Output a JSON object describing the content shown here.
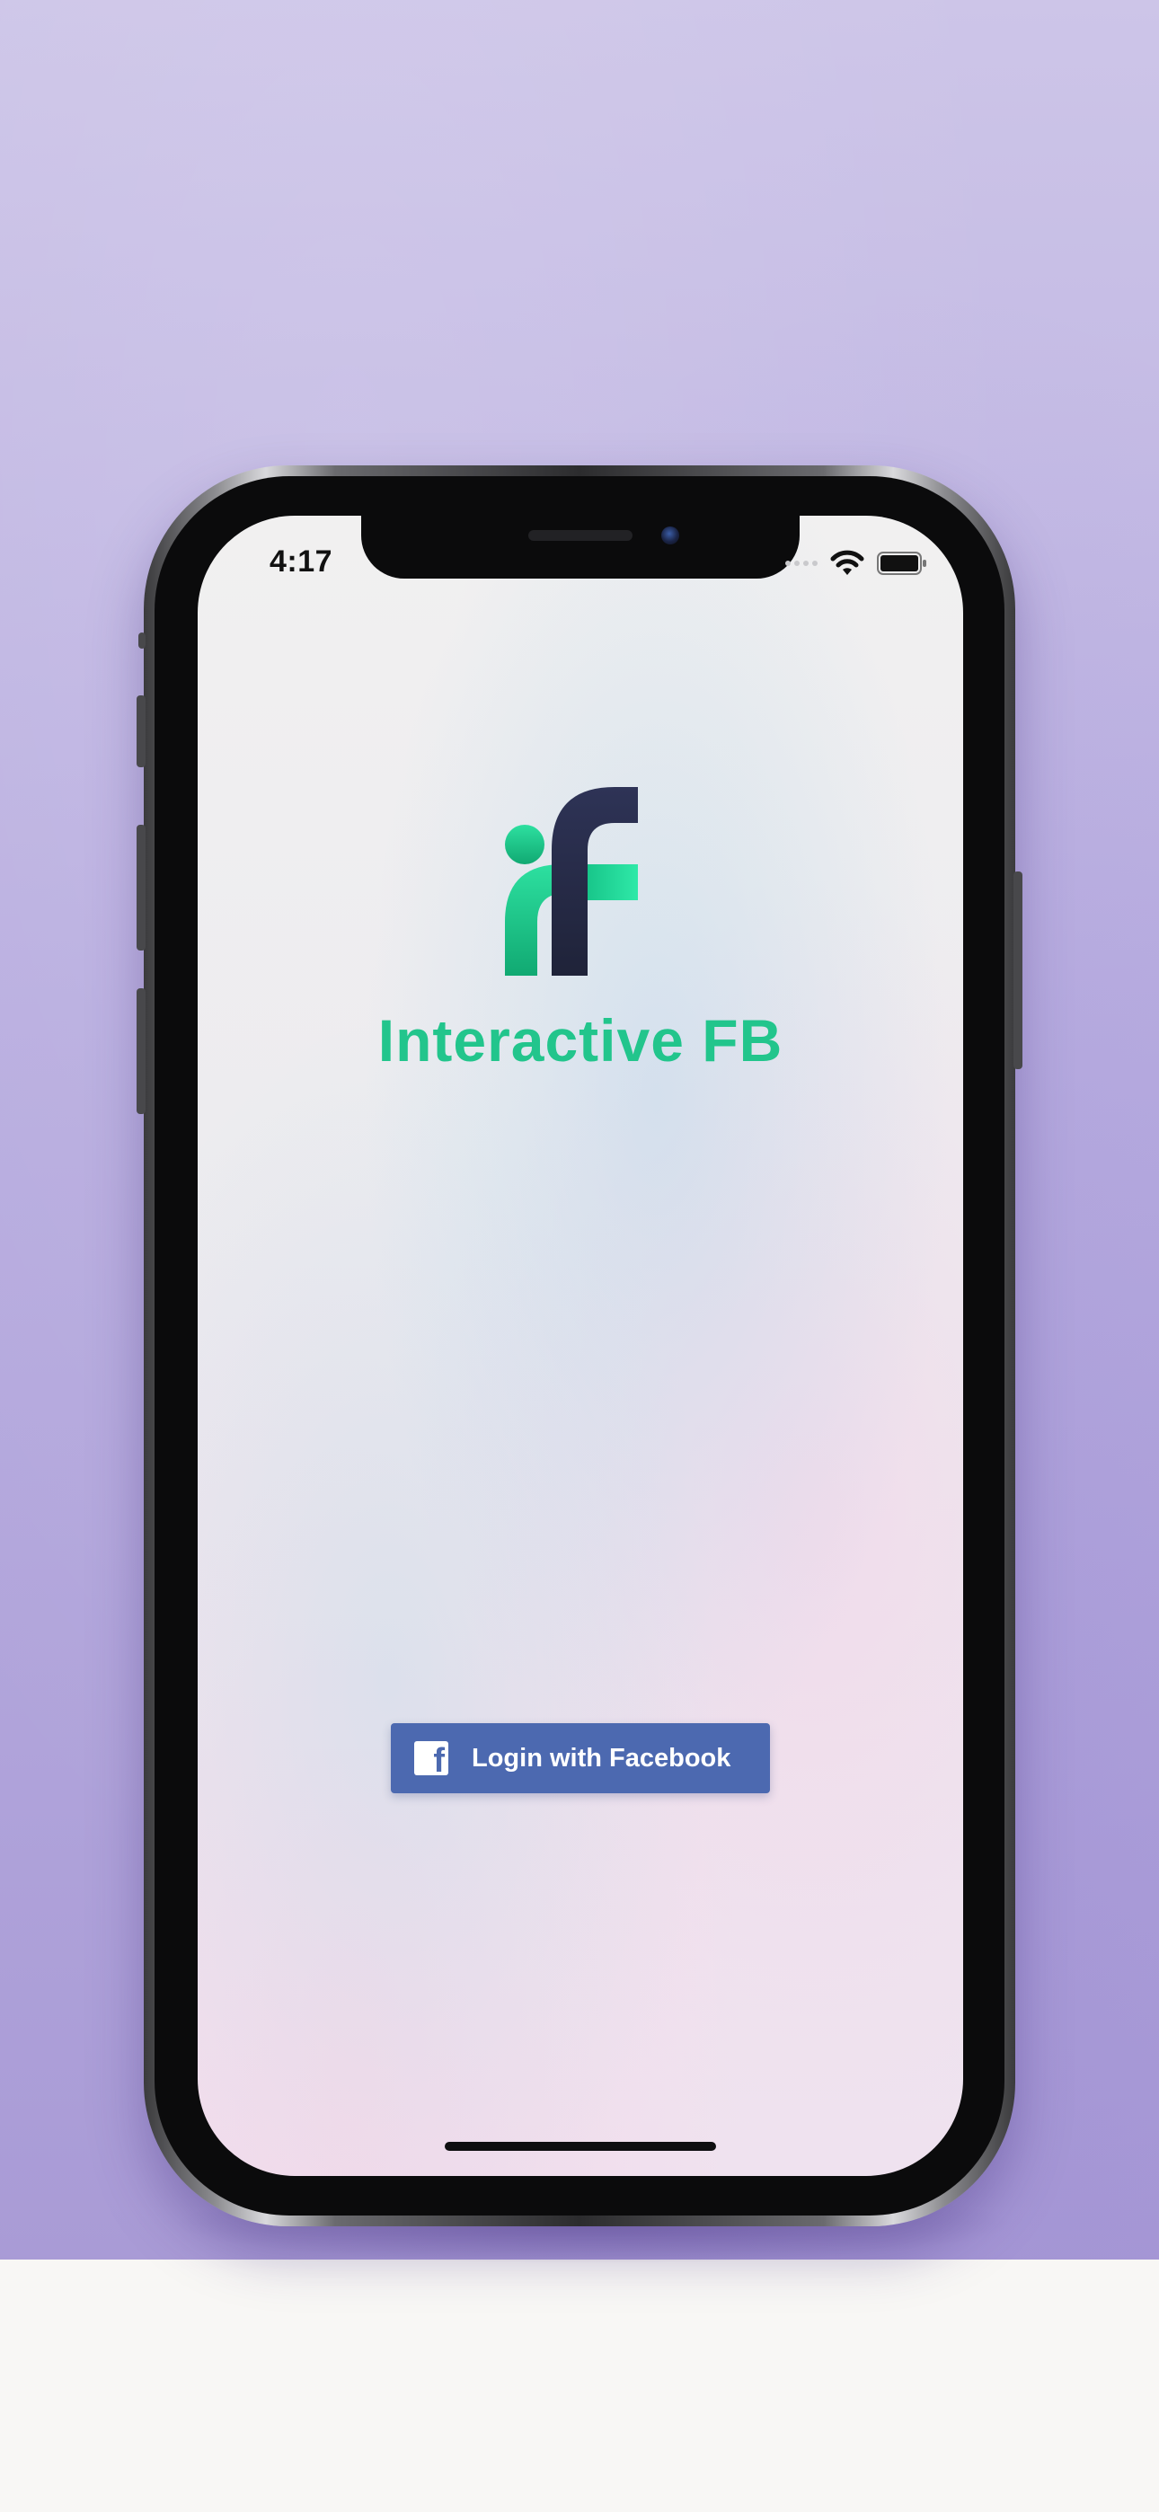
{
  "status_bar": {
    "time": "4:17",
    "icons": [
      "signal-dots-icon",
      "wifi-icon",
      "battery-icon"
    ]
  },
  "app": {
    "logo_icon": "interactive-fb-logo-icon",
    "title": "Interactive FB",
    "title_color": "#22c58c"
  },
  "login_button": {
    "label": "Login with Facebook",
    "icon": "facebook-icon",
    "icon_glyph": "f",
    "background": "#4c69b0"
  },
  "home_indicator": {
    "icon": "home-indicator-bar"
  }
}
